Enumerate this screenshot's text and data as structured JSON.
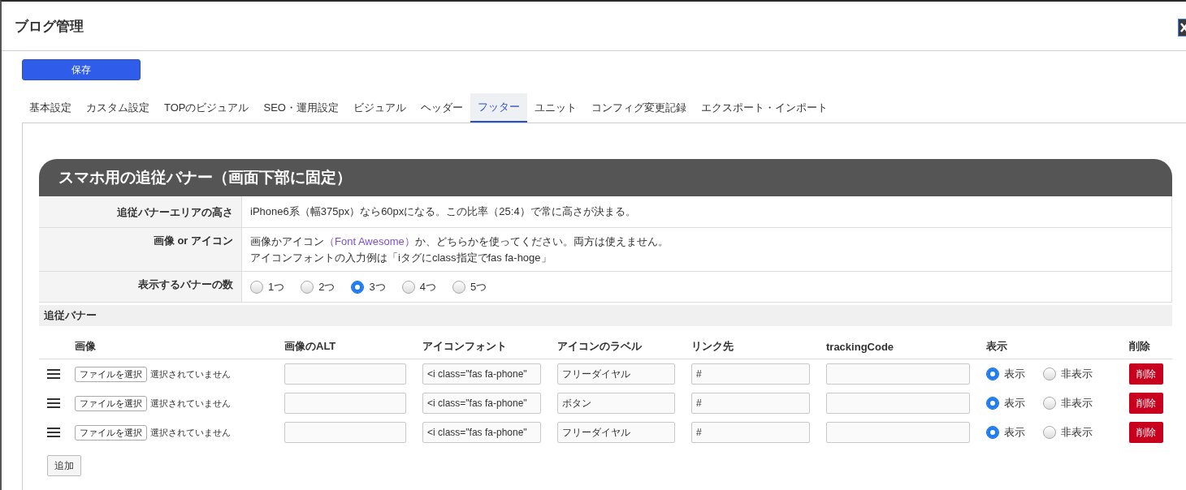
{
  "dialog": {
    "title": "ブログ管理"
  },
  "save_button": "保存",
  "tabs": [
    {
      "label": "基本設定",
      "selected": false
    },
    {
      "label": "カスタム設定",
      "selected": false
    },
    {
      "label": "TOPのビジュアル",
      "selected": false
    },
    {
      "label": "SEO・運用設定",
      "selected": false
    },
    {
      "label": "ビジュアル",
      "selected": false
    },
    {
      "label": "ヘッダー",
      "selected": false
    },
    {
      "label": "フッター",
      "selected": true
    },
    {
      "label": "ユニット",
      "selected": false
    },
    {
      "label": "コンフィグ変更記録",
      "selected": false
    },
    {
      "label": "エクスポート・インポート",
      "selected": false
    }
  ],
  "section": {
    "title": "スマホ用の追従バナー（画面下部に固定）",
    "settings": [
      {
        "kind": "text",
        "label": "追従バナーエリアの高さ",
        "lines": [
          [
            {
              "text": "iPhone6系（幅375px）なら60pxになる。この比率（25:4）で常に高さが決まる。"
            }
          ]
        ]
      },
      {
        "kind": "text",
        "label": "画像 or アイコン",
        "lines": [
          [
            {
              "text": "画像かアイコン"
            },
            {
              "link": "（Font Awesome）"
            },
            {
              "text": "か、どちらかを使ってください。両方は使えません。"
            }
          ],
          [
            {
              "text": "アイコンフォントの入力例は「iタグにclass指定でfas fa-hoge」"
            }
          ]
        ]
      },
      {
        "kind": "radio",
        "label": "表示するバナーの数",
        "options": [
          {
            "label": "1つ",
            "selected": false
          },
          {
            "label": "2つ",
            "selected": false
          },
          {
            "label": "3つ",
            "selected": true
          },
          {
            "label": "4つ",
            "selected": false
          },
          {
            "label": "5つ",
            "selected": false
          }
        ]
      }
    ]
  },
  "banners": {
    "title": "追従バナー",
    "columns": [
      "画像",
      "画像のALT",
      "アイコンフォント",
      "アイコンのラベル",
      "リンク先",
      "trackingCode",
      "表示",
      "削除"
    ],
    "rows": [
      {
        "file_button": "ファイルを選択",
        "file_status": "選択されていません",
        "icon_font": "<i class=\"fas fa-phone\"",
        "icon_label": "フリーダイヤル",
        "link": "#",
        "display": [
          {
            "label": "表示",
            "selected": true
          },
          {
            "label": "非表示",
            "selected": false
          }
        ],
        "delete_button": "削除"
      },
      {
        "file_button": "ファイルを選択",
        "file_status": "選択されていません",
        "icon_font": "<i class=\"fas fa-phone\"",
        "icon_label": "ボタン",
        "link": "#",
        "display": [
          {
            "label": "表示",
            "selected": true
          },
          {
            "label": "非表示",
            "selected": false
          }
        ],
        "delete_button": "削除"
      },
      {
        "file_button": "ファイルを選択",
        "file_status": "選択されていません",
        "icon_font": "<i class=\"fas fa-phone\"",
        "icon_label": "フリーダイヤル",
        "link": "#",
        "display": [
          {
            "label": "表示",
            "selected": true
          },
          {
            "label": "非表示",
            "selected": false
          }
        ],
        "delete_button": "削除"
      }
    ],
    "add_button": "追加"
  }
}
